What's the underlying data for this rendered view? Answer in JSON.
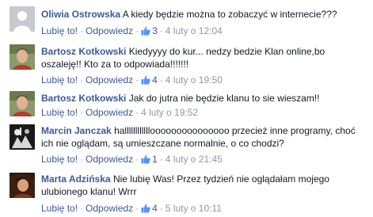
{
  "comments": [
    {
      "author": "Oliwia Ostrowska",
      "text": "A kiedy będzie można to zobaczyć w internecie???",
      "like_label": "Lubię to!",
      "reply_label": "Odpowiedz",
      "likes": "3",
      "timestamp": "4 luty o 12:04",
      "has_likes": true
    },
    {
      "author": "Bartosz Kotkowski",
      "text": "Kiedyyyy do kur... nedzy bedzie Klan online,bo oszaleję!! Kto za to odpowiada!!!!!!!",
      "like_label": "Lubię to!",
      "reply_label": "Odpowiedz",
      "likes": "4",
      "timestamp": "4 luty o 19:50",
      "has_likes": true
    },
    {
      "author": "Bartosz Kotkowski",
      "text": "Jak do jutra nie będzie klanu to sie wieszam!!",
      "like_label": "Lubię to!",
      "reply_label": "Odpowiedz",
      "likes": "",
      "timestamp": "4 luty o 19:52",
      "has_likes": false
    },
    {
      "author": "Marcin Janczak",
      "text": "hallllllllllllooooooooooooooo przecież inne programy, choć ich nie oglądam, są umieszczane normalnie, o co chodzi?",
      "like_label": "Lubię to!",
      "reply_label": "Odpowiedz",
      "likes": "1",
      "timestamp": "4 luty o 21:45",
      "has_likes": true
    },
    {
      "author": "Marta Adzińska",
      "text": "Nie lubię Was! Przez tydzień nie oglądałam mojego ulubionego klanu! Wrrr",
      "like_label": "Lubię to!",
      "reply_label": "Odpowiedz",
      "likes": "4",
      "timestamp": "5 luty o 10:11",
      "has_likes": true
    }
  ]
}
